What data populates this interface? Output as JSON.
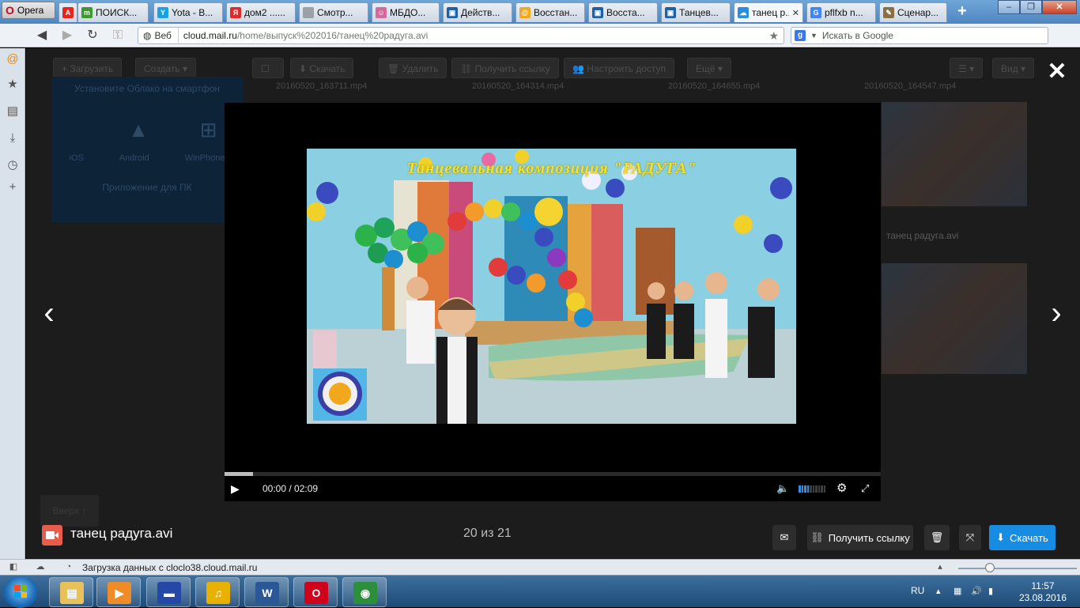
{
  "browser": {
    "menu_label": "Opera",
    "tabs": [
      {
        "label": "ПОИСК...",
        "color": "#3b9a2b",
        "glyph": "m"
      },
      {
        "label": "Yota - В...",
        "color": "#1aa1e1",
        "glyph": "Y"
      },
      {
        "label": "дом2 ......",
        "color": "#e02a2a",
        "glyph": "Я"
      },
      {
        "label": "Смотр...",
        "color": "#9aa0a6",
        "glyph": ""
      },
      {
        "label": "МБДО...",
        "color": "#d46a9b",
        "glyph": "☺"
      },
      {
        "label": "Действ...",
        "color": "#1f5fa6",
        "glyph": "▣"
      },
      {
        "label": "Восстан...",
        "color": "#f2a81d",
        "glyph": "@"
      },
      {
        "label": "Восста...",
        "color": "#1f5fa6",
        "glyph": "▣"
      },
      {
        "label": "Танцев...",
        "color": "#1f5fa6",
        "glyph": "▣"
      },
      {
        "label": "танец р...",
        "color": "#2a8de0",
        "glyph": "☁",
        "active": true
      },
      {
        "label": "pflfxb n...",
        "color": "#4285f4",
        "glyph": "G"
      },
      {
        "label": "Сценар...",
        "color": "#8a6f45",
        "glyph": "✎"
      }
    ],
    "new_tab_label": "+",
    "address": {
      "scheme_label": "Веб",
      "host": "cloud.mail.ru",
      "path": "/home/выпуск%202016/танец%20радуга.avi"
    },
    "search_placeholder": "Искать в Google",
    "status_text": "Загрузка данных с cloclo38.cloud.mail.ru"
  },
  "background_page": {
    "toolbar": [
      "Загрузить",
      "Создать",
      "Скачать",
      "Удалить",
      "Получить ссылку",
      "Настроить доступ",
      "Ещё",
      "Вид"
    ],
    "promo_title": "Установите Облако на смартфон",
    "promo_platforms": [
      "iOS",
      "Android",
      "WinPhone"
    ],
    "promo_pc": "Приложение для ПК",
    "files": [
      "20160520_163711.mp4",
      "20160520_164314.mp4",
      "20160520_164655.mp4",
      "20160520_164547.mp4"
    ],
    "side_file": "танец радуга.avi",
    "up_button": "Вверх ↑"
  },
  "video": {
    "caption": "Танцевальная композиция \"РАДУГА\""
  },
  "player": {
    "time_current": "00:00",
    "time_total": "02:09",
    "time_separator": " / ",
    "progress_fraction": 0.043,
    "volume_level": 0.4
  },
  "viewer": {
    "file_name": "танец радуга.avi",
    "counter": "20 из 21",
    "get_link_label": "Получить ссылку",
    "download_label": "Скачать"
  },
  "taskbar": {
    "language": "RU",
    "time": "11:57",
    "date": "23.08.2016",
    "apps": [
      {
        "name": "explorer",
        "color": "#e9c15b",
        "glyph": "▤"
      },
      {
        "name": "media",
        "color": "#f08c28",
        "glyph": "▶"
      },
      {
        "name": "floppy",
        "color": "#2547a8",
        "glyph": "▬"
      },
      {
        "name": "audio",
        "color": "#e8b000",
        "glyph": "♫"
      },
      {
        "name": "word",
        "color": "#2b5797",
        "glyph": "W"
      },
      {
        "name": "opera",
        "color": "#d0021b",
        "glyph": "O"
      },
      {
        "name": "eye",
        "color": "#2c8f3a",
        "glyph": "◉"
      }
    ]
  }
}
